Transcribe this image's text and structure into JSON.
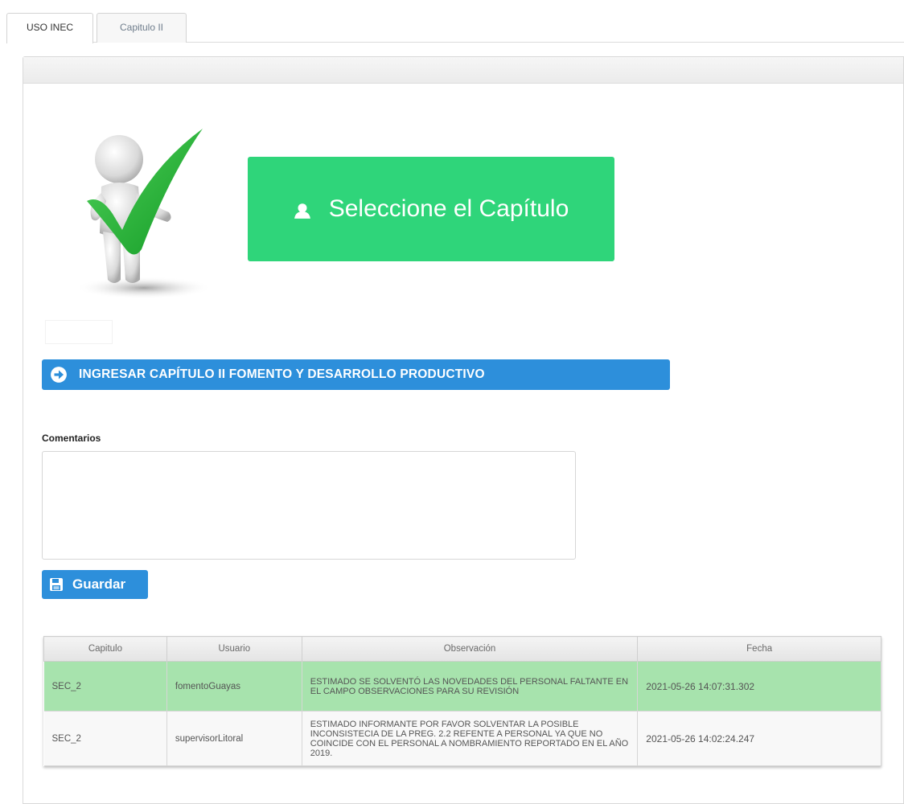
{
  "tabs": [
    {
      "label": "USO INEC",
      "active": true
    },
    {
      "label": "Capitulo II",
      "active": false
    }
  ],
  "banner": {
    "label": "Seleccione el Capítulo",
    "color": "#2fd57a"
  },
  "enter_button": {
    "label": "INGRESAR CAPÍTULO II FOMENTO Y DESARROLLO PRODUCTIVO",
    "color": "#2d8fdb"
  },
  "comments": {
    "label": "Comentarios",
    "value": ""
  },
  "save_button": {
    "label": "Guardar"
  },
  "table": {
    "headers": [
      "Capitulo",
      "Usuario",
      "Observación",
      "Fecha"
    ],
    "rows": [
      {
        "capitulo": "SEC_2",
        "usuario": "fomentoGuayas",
        "observacion": "ESTIMADO SE SOLVENTÓ LAS NOVEDADES DEL PERSONAL FALTANTE EN EL CAMPO OBSERVACIONES PARA SU REVISIÓN",
        "fecha": "2021-05-26 14:07:31.302",
        "highlight": "#a7e3ad"
      },
      {
        "capitulo": "SEC_2",
        "usuario": "supervisorLitoral",
        "observacion": "ESTIMADO INFORMANTE POR FAVOR SOLVENTAR LA POSIBLE INCONSISTECIA DE LA PREG. 2.2 REFENTE A PERSONAL YA QUE NO COINCIDE CON EL PERSONAL A NOMBRAMIENTO REPORTADO EN EL AÑO 2019.",
        "fecha": "2021-05-26 14:02:24.247"
      }
    ]
  }
}
